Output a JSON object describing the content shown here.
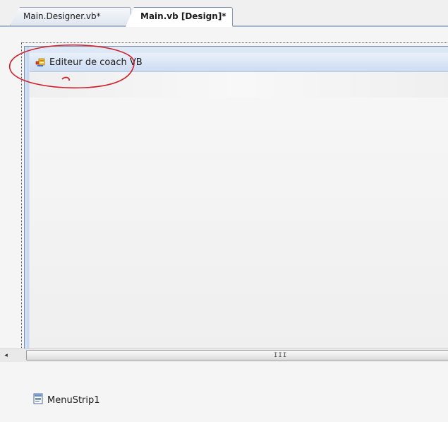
{
  "tabs": [
    {
      "label": "Main.Designer.vb*",
      "active": false
    },
    {
      "label": "Main.vb [Design]*",
      "active": true
    }
  ],
  "form": {
    "menu_item_label": "Editeur de coach VB",
    "menu_item_icon": "menu-strip-item-icon"
  },
  "scrollbar": {
    "left_arrow": "◂",
    "grip": "III"
  },
  "tray": {
    "component_label": "MenuStrip1",
    "component_icon": "menustrip-icon"
  },
  "colors": {
    "annotation": "#d0202a",
    "menu_bar": "#dce7f5",
    "tab_border": "#7f93b4"
  }
}
